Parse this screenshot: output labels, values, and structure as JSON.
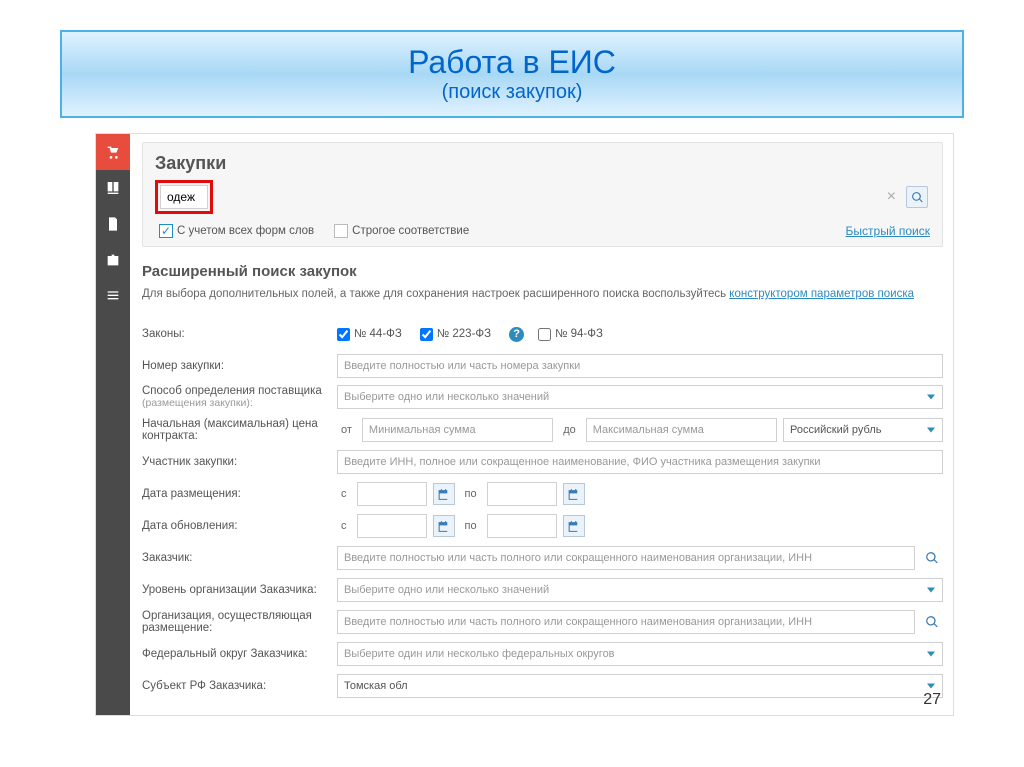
{
  "slide": {
    "title": "Работа в ЕИС",
    "subtitle": "(поиск закупок)"
  },
  "panel": {
    "title": "Закупки"
  },
  "search": {
    "value": "одеж",
    "opt_all_forms": "С учетом всех форм слов",
    "opt_strict": "Строгое соответствие",
    "quick_link": "Быстрый поиск"
  },
  "advanced": {
    "title": "Расширенный поиск закупок",
    "desc_prefix": "Для выбора дополнительных полей, а также для сохранения настроек расширенного поиска воспользуйтесь ",
    "desc_link": "конструктором параметров поиска"
  },
  "labels": {
    "laws": "Законы:",
    "purchase_no": "Номер закупки:",
    "supplier_method": "Способ определения поставщика",
    "supplier_method_sub": "(размещения закупки):",
    "initial_price": "Начальная (максимальная) цена контракта:",
    "participant": "Участник закупки:",
    "placement_date": "Дата размещения:",
    "update_date": "Дата обновления:",
    "customer": "Заказчик:",
    "org_level": "Уровень организации Заказчика:",
    "placing_org": "Организация, осуществляющая размещение:",
    "fed_district": "Федеральный округ Заказчика:",
    "subject_rf": "Субъект РФ Заказчика:"
  },
  "laws": {
    "law44": "№ 44-ФЗ",
    "law223": "№ 223-ФЗ",
    "law94": "№ 94-ФЗ"
  },
  "placeholders": {
    "purchase_no": "Введите полностью или часть номера закупки",
    "select_one_many": "Выберите одно или несколько значений",
    "min_sum": "Минимальная сумма",
    "max_sum": "Максимальная сумма",
    "currency": "Российский рубль",
    "participant": "Введите ИНН, полное или сокращенное наименование, ФИО участника размещения закупки",
    "org_name": "Введите полностью или часть полного или сокращенного наименования организации, ИНН",
    "fed_districts": "Выберите один или несколько федеральных округов",
    "subject_value": "Томская обл"
  },
  "range": {
    "from": "от",
    "to": "до",
    "s": "с",
    "po": "по"
  },
  "page": "27"
}
